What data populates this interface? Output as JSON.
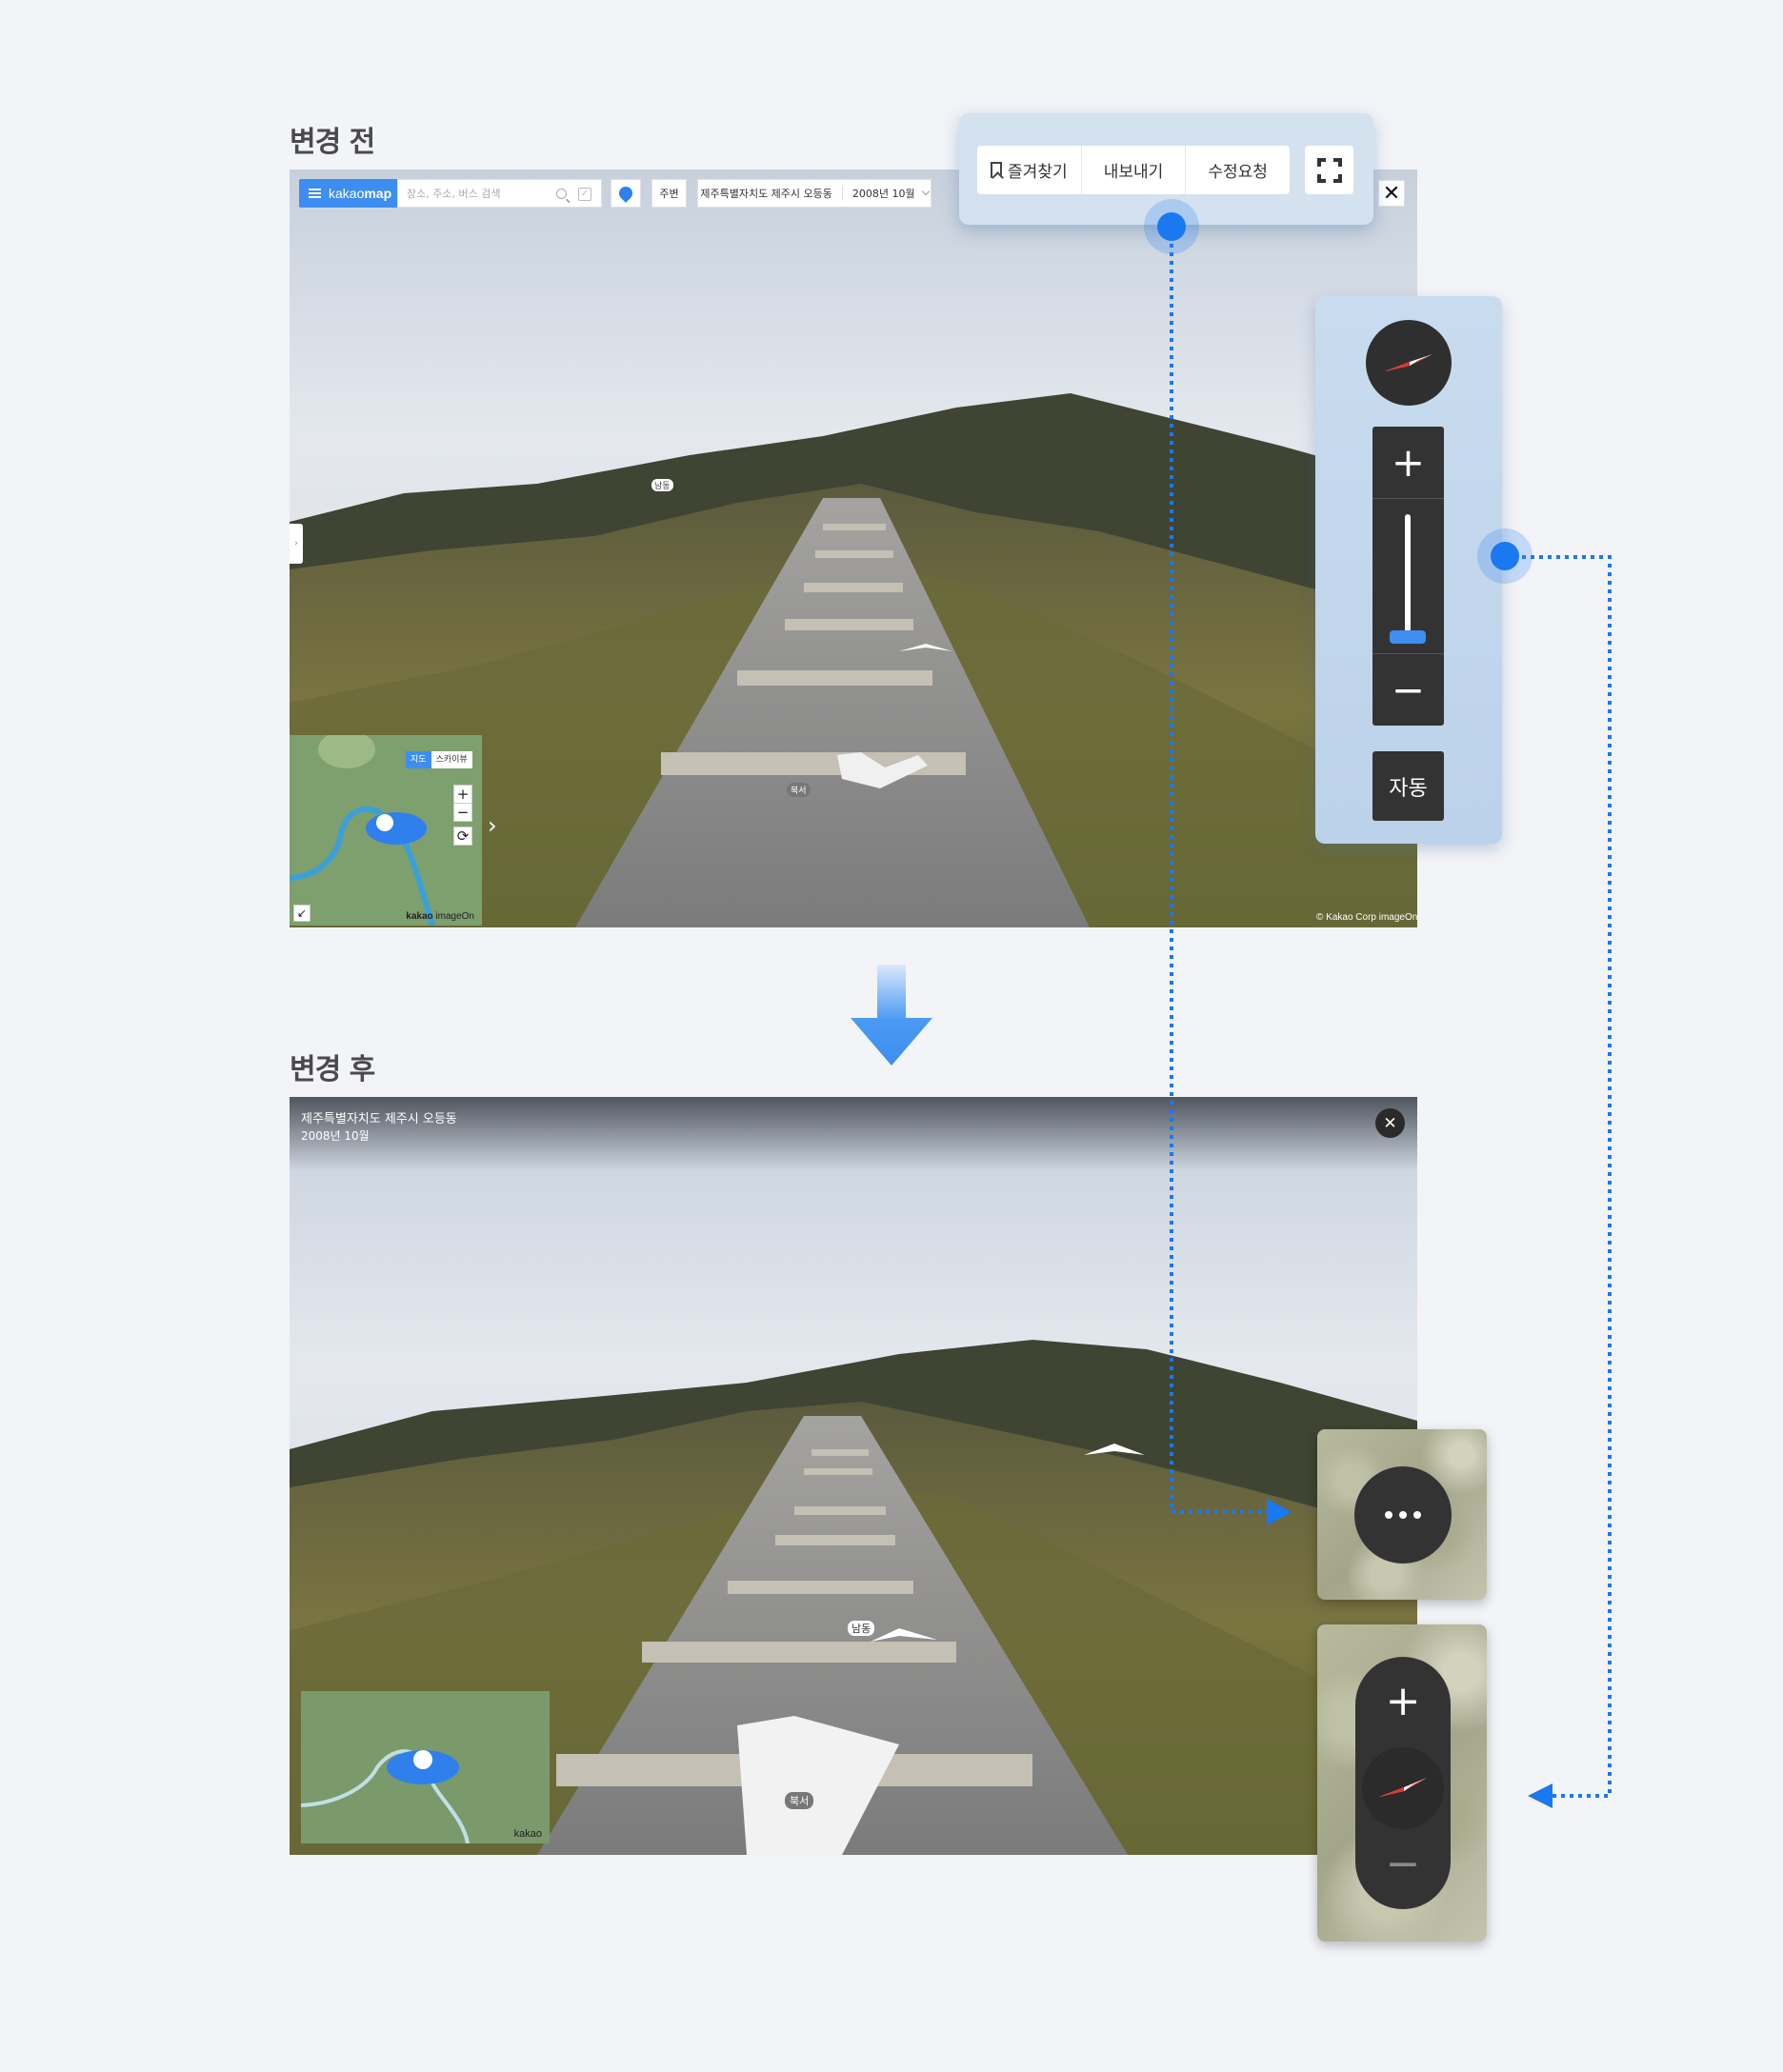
{
  "before": {
    "title": "변경 전",
    "topbar": {
      "brand_light": "kakao",
      "brand_bold": "map",
      "search_placeholder": "장소, 주소, 버스 검색",
      "nearby_label": "주변",
      "address": "제주특별자치도 제주시 오등동",
      "date": "2008년 10월"
    },
    "toolbar": {
      "favorite_label": "즐겨찾기",
      "export_label": "내보내기",
      "edit_request_label": "수정요청"
    },
    "zoom_panel": {
      "plus": "+",
      "minus": "−",
      "auto_label": "자동",
      "zoom_level_fraction": 0.08
    },
    "road_labels": {
      "north": "남동",
      "south": "북서"
    },
    "minimap": {
      "map_tab": "지도",
      "skyview_tab": "스카이뷰",
      "plus": "+",
      "minus": "−",
      "logo_bold": "kakao",
      "logo_rest": " imageOn"
    },
    "copyright": "© Kakao Corp  imageOn"
  },
  "after": {
    "title": "변경 후",
    "address": "제주특별자치도 제주시 오등동",
    "date": "2008년 10월",
    "road_labels": {
      "north": "남동",
      "south": "북서"
    },
    "zoom": {
      "plus": "+",
      "minus": "−"
    },
    "minimap_logo": "kakao"
  },
  "colors": {
    "accent_blue": "#1a78f0",
    "kakao_blue": "#3d8ef0",
    "compass_red": "#e8322c",
    "control_dark": "#333333"
  }
}
